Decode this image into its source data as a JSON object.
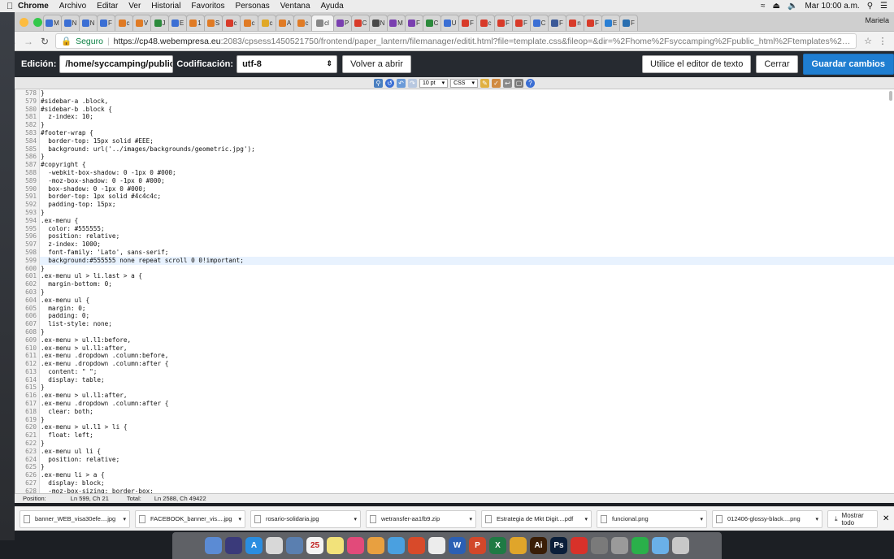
{
  "menubar": {
    "app": "Chrome",
    "items": [
      "Archivo",
      "Editar",
      "Ver",
      "Historial",
      "Favoritos",
      "Personas",
      "Ventana",
      "Ayuda"
    ],
    "clock": "Mar 10:00 a.m."
  },
  "browser": {
    "profile": "Mariela",
    "tabs": [
      {
        "letter": "M",
        "color": "#3b6fd4"
      },
      {
        "letter": "N",
        "color": "#3b6fd4"
      },
      {
        "letter": "N",
        "color": "#3b6fd4"
      },
      {
        "letter": "F",
        "color": "#3b6fd4"
      },
      {
        "letter": "c",
        "color": "#e07b25"
      },
      {
        "letter": "V",
        "color": "#e07b25"
      },
      {
        "letter": "J",
        "color": "#2c8a3c"
      },
      {
        "letter": "E",
        "color": "#3b6fd4"
      },
      {
        "letter": "1",
        "color": "#e07b25"
      },
      {
        "letter": "S",
        "color": "#e07b25"
      },
      {
        "letter": "c",
        "color": "#d83b2a"
      },
      {
        "letter": "c",
        "color": "#e07b25"
      },
      {
        "letter": "c",
        "color": "#e0a825"
      },
      {
        "letter": "A",
        "color": "#e07b25"
      },
      {
        "letter": "c",
        "color": "#e07b25"
      },
      {
        "letter": "cl",
        "color": "#888888",
        "active": true
      },
      {
        "letter": "P",
        "color": "#7a3fb0"
      },
      {
        "letter": "C",
        "color": "#d83b2a"
      },
      {
        "letter": "N",
        "color": "#4a4a4a"
      },
      {
        "letter": "M",
        "color": "#7a3fb0"
      },
      {
        "letter": "F",
        "color": "#7a3fb0"
      },
      {
        "letter": "C",
        "color": "#2c8a3c"
      },
      {
        "letter": "U",
        "color": "#3b6fd4"
      },
      {
        "letter": "F",
        "color": "#d83b2a"
      },
      {
        "letter": "c",
        "color": "#d83b2a"
      },
      {
        "letter": "F",
        "color": "#d83b2a"
      },
      {
        "letter": "F",
        "color": "#d83b2a"
      },
      {
        "letter": "C",
        "color": "#3b6fd4"
      },
      {
        "letter": "F",
        "color": "#3b5998"
      },
      {
        "letter": "n",
        "color": "#d83b2a"
      },
      {
        "letter": "F",
        "color": "#d83b2a"
      },
      {
        "letter": "E",
        "color": "#2a7fd4"
      },
      {
        "letter": "F",
        "color": "#2a6fb0"
      }
    ],
    "url_secure": "Seguro",
    "url_host": "https://cp48.webempresa.eu",
    "url_path": ":2083/cpsess1450521750/frontend/paper_lantern/filemanager/editit.html?file=template.css&fileop=&dir=%2Fhome%2Fsyccamping%2Fpublic_html%2Ftemplates%2Ftx_zenith%2Fcss&d..."
  },
  "editor": {
    "edicion_label": "Edición:",
    "path_value": "/home/syccamping/public",
    "codificacion_label": "Codificación:",
    "encoding_value": "utf-8",
    "reopen_label": "Volver a abrir",
    "text_editor_label": "Utilice el editor de texto",
    "close_label": "Cerrar",
    "save_label": "Guardar cambios",
    "font_size": "10 pt",
    "syntax": "CSS"
  },
  "code": {
    "highlight_line": "599",
    "lines": [
      [
        "578",
        "}"
      ],
      [
        "579",
        "#sidebar-a .block,"
      ],
      [
        "580",
        "#sidebar-b .block {"
      ],
      [
        "581",
        "  z-index: 10;"
      ],
      [
        "582",
        "}"
      ],
      [
        "583",
        "#footer-wrap {"
      ],
      [
        "584",
        "  border-top: 15px solid #EEE;"
      ],
      [
        "585",
        "  background: url('../images/backgrounds/geometric.jpg');"
      ],
      [
        "586",
        "}"
      ],
      [
        "587",
        "#copyright {"
      ],
      [
        "588",
        "  -webkit-box-shadow: 0 -1px 0 #000;"
      ],
      [
        "589",
        "  -moz-box-shadow: 0 -1px 0 #000;"
      ],
      [
        "590",
        "  box-shadow: 0 -1px 0 #000;"
      ],
      [
        "591",
        "  border-top: 1px solid #4c4c4c;"
      ],
      [
        "592",
        "  padding-top: 15px;"
      ],
      [
        "593",
        "}"
      ],
      [
        "594",
        ".ex-menu {"
      ],
      [
        "595",
        "  color: #555555;"
      ],
      [
        "596",
        "  position: relative;"
      ],
      [
        "597",
        "  z-index: 1000;"
      ],
      [
        "598",
        "  font-family: 'Lato', sans-serif;"
      ],
      [
        "599",
        "  background:#555555 none repeat scroll 0 0!important;"
      ],
      [
        "600",
        "}"
      ],
      [
        "601",
        ".ex-menu ul > li.last > a {"
      ],
      [
        "602",
        "  margin-bottom: 0;"
      ],
      [
        "603",
        "}"
      ],
      [
        "604",
        ".ex-menu ul {"
      ],
      [
        "605",
        "  margin: 0;"
      ],
      [
        "606",
        "  padding: 0;"
      ],
      [
        "607",
        "  list-style: none;"
      ],
      [
        "608",
        "}"
      ],
      [
        "609",
        ".ex-menu > ul.l1:before,"
      ],
      [
        "610",
        ".ex-menu > ul.l1:after,"
      ],
      [
        "611",
        ".ex-menu .dropdown .column:before,"
      ],
      [
        "612",
        ".ex-menu .dropdown .column:after {"
      ],
      [
        "613",
        "  content: \" \";"
      ],
      [
        "614",
        "  display: table;"
      ],
      [
        "615",
        "}"
      ],
      [
        "616",
        ".ex-menu > ul.l1:after,"
      ],
      [
        "617",
        ".ex-menu .dropdown .column:after {"
      ],
      [
        "618",
        "  clear: both;"
      ],
      [
        "619",
        "}"
      ],
      [
        "620",
        ".ex-menu > ul.l1 > li {"
      ],
      [
        "621",
        "  float: left;"
      ],
      [
        "622",
        "}"
      ],
      [
        "623",
        ".ex-menu ul li {"
      ],
      [
        "624",
        "  position: relative;"
      ],
      [
        "625",
        "}"
      ],
      [
        "626",
        ".ex-menu li > a {"
      ],
      [
        "627",
        "  display: block;"
      ],
      [
        "628",
        "  -moz-box-sizing: border-box;"
      ]
    ]
  },
  "status": {
    "position_label": "Position:",
    "position_value": "Ln 599, Ch 21",
    "total_label": "Total:",
    "total_value": "Ln 2588, Ch 49422"
  },
  "downloads": {
    "items": [
      "banner_WEB_visa30efe....jpg",
      "FACEBOOK_banner_vis....jpg",
      "rosario-solidaria.jpg",
      "wetransfer-aa1fb9.zip",
      "Estrategia de Mkt Digit....pdf",
      "funcional.png",
      "012406-glossy-black....png"
    ],
    "show_all": "Mostrar todo"
  },
  "dock": {
    "apps": [
      {
        "label": "",
        "color": "#5b8bd4"
      },
      {
        "label": "",
        "color": "#3a3a7a"
      },
      {
        "label": "A",
        "color": "#2a8de0"
      },
      {
        "label": "",
        "color": "#d8d8d8"
      },
      {
        "label": "",
        "color": "#5a7fb0"
      },
      {
        "label": "25",
        "color": "#f4f4f4"
      },
      {
        "label": "",
        "color": "#f2e27a"
      },
      {
        "label": "",
        "color": "#e24a7a"
      },
      {
        "label": "",
        "color": "#e8a040"
      },
      {
        "label": "",
        "color": "#4aa0e0"
      },
      {
        "label": "",
        "color": "#d84a2a"
      },
      {
        "label": "",
        "color": "#ececec"
      },
      {
        "label": "W",
        "color": "#2b5fb4"
      },
      {
        "label": "P",
        "color": "#d2472a"
      },
      {
        "label": "X",
        "color": "#1f7a44"
      },
      {
        "label": "",
        "color": "#e0a52a"
      },
      {
        "label": "Ai",
        "color": "#3a1d06"
      },
      {
        "label": "Ps",
        "color": "#0a1e3a"
      },
      {
        "label": "",
        "color": "#d8312a"
      },
      {
        "label": "",
        "color": "#7a7a7a"
      },
      {
        "label": "",
        "color": "#9a9a9a"
      },
      {
        "label": "",
        "color": "#2ab04a"
      },
      {
        "label": "",
        "color": "#6ab0e8"
      },
      {
        "label": "",
        "color": "#c8c8c8"
      }
    ]
  }
}
